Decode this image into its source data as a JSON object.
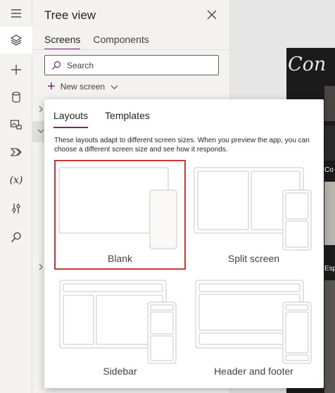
{
  "rail": {
    "items": [
      {
        "icon": "menu-icon"
      },
      {
        "icon": "layers-icon",
        "active": true
      },
      {
        "icon": "plus-icon"
      },
      {
        "icon": "data-icon"
      },
      {
        "icon": "media-icon"
      },
      {
        "icon": "power-automate-icon"
      },
      {
        "icon": "variables-icon",
        "text": "(x)"
      },
      {
        "icon": "tools-icon"
      },
      {
        "icon": "search-icon"
      }
    ]
  },
  "tree": {
    "title": "Tree view",
    "tabs": [
      {
        "label": "Screens",
        "active": true
      },
      {
        "label": "Components",
        "active": false
      }
    ],
    "search": {
      "placeholder": "Search",
      "value": ""
    },
    "new_screen_label": "New screen"
  },
  "popup": {
    "tabs": [
      {
        "label": "Layouts",
        "active": true
      },
      {
        "label": "Templates",
        "active": false
      }
    ],
    "description": "These layouts adapt to different screen sizes. When you preview the app, you can choose a different screen size and see how it responds.",
    "layouts": [
      {
        "label": "Blank",
        "selected": true
      },
      {
        "label": "Split screen",
        "selected": false
      },
      {
        "label": "Sidebar",
        "selected": false
      },
      {
        "label": "Header and footer",
        "selected": false
      }
    ]
  },
  "preview": {
    "logo_text": "Con",
    "tile_labels": [
      "Co",
      "Esp"
    ]
  },
  "colors": {
    "accent": "#742774",
    "selection": "#d13438",
    "panel_bg": "#f3f2f1"
  }
}
